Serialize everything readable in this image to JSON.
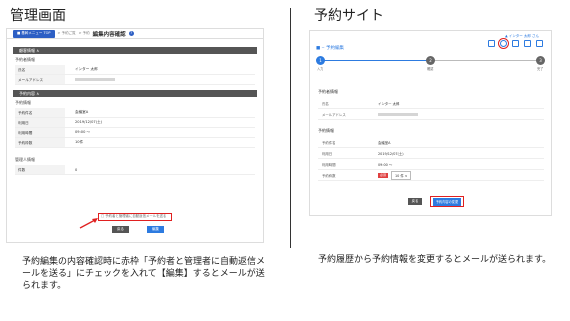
{
  "left_panel": {
    "heading": "管理画面",
    "caption": "予約編集の内容確認時に赤枠「予約者と管理者に自動返信メールを送る」にチェックを入れて【編集】するとメールが送られます。",
    "topbar": {
      "home_label": "■ 基幹メニュー TOP",
      "crumbs": [
        "> 予約ご覧",
        "> 予約",
        "> 編集内容確認"
      ],
      "title": "編集内容確認"
    },
    "sections": [
      {
        "bar": "顧客情報 ∧",
        "subtitle": "予約者情報",
        "rows": [
          {
            "label": "氏名",
            "value": "インター 太郎"
          },
          {
            "label": "メールアドレス",
            "value": ""
          }
        ]
      },
      {
        "bar": "予約内容 ∧",
        "subtitle": "予約情報",
        "rows": [
          {
            "label": "予約件名",
            "value": "会議室A"
          },
          {
            "label": "利用日",
            "value": "2019/12/07(土)"
          },
          {
            "label": "利用時間",
            "value": "09:00 ～"
          },
          {
            "label": "予約枠数",
            "value": "10件"
          }
        ]
      }
    ],
    "other_section": {
      "subtitle": "管理人情報",
      "rows": [
        {
          "label": "件数",
          "value": "0"
        }
      ]
    },
    "notify_checkbox_label": "□ 予約者と管理者に自動返信メールを送る",
    "back_button": "戻る",
    "edit_button": "編集"
  },
  "right_panel": {
    "heading": "予約サイト",
    "caption": "予約履歴から予約情報を変更するとメールが送られます。",
    "user_link": "▲ インター 太郎 さん",
    "site_title": "■ ‒ 予約編集",
    "steps": [
      {
        "num": "1",
        "label": "入力",
        "active": true
      },
      {
        "num": "2",
        "label": "確認",
        "active": false
      },
      {
        "num": "3",
        "label": "完了",
        "active": false
      }
    ],
    "booker_section": "予約者情報",
    "booker_rows": [
      {
        "label": "氏名",
        "value": "インター 太郎"
      },
      {
        "label": "メールアドレス",
        "value": ""
      }
    ],
    "booking_section": "予約情報",
    "booking_rows": [
      {
        "label": "予約件名",
        "value": "会議室A",
        "required": false
      },
      {
        "label": "利用日",
        "value": "2019/12/07(土)",
        "required": false
      },
      {
        "label": "利用時間",
        "value": "09:00 ～",
        "required": false
      },
      {
        "label": "予約枠数",
        "value": "10 件 ∨",
        "required": true,
        "required_label": "必須"
      }
    ],
    "back_button": "戻る",
    "submit_button": "予約内容の変更"
  },
  "colors": {
    "accent": "#2d7be0",
    "highlight": "#e02020",
    "section_bar": "#555555"
  }
}
